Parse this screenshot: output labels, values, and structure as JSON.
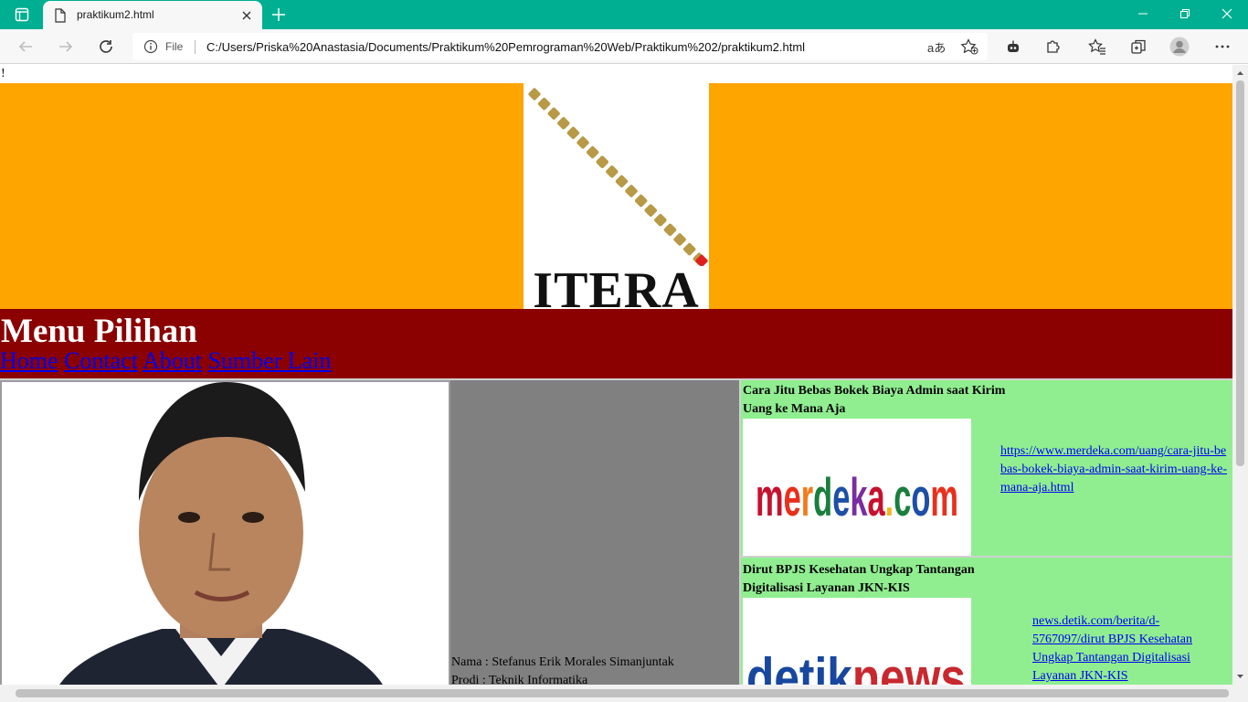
{
  "browser": {
    "tab_title": "praktikum2.html",
    "address_scheme_label": "File",
    "url": "C:/Users/Priska%20Anastasia/Documents/Praktikum%20Pemrograman%20Web/Praktikum%202/praktikum2.html",
    "read_aloud_glyph": "aあ"
  },
  "page": {
    "top_text": "!",
    "logo_text": "ITERA",
    "menu": {
      "title": "Menu Pilihan",
      "links": [
        "Home",
        "Contact",
        "About",
        "Sumber Lain"
      ]
    },
    "profile": {
      "name_line": "Nama : Stefanus Erik Morales Simanjuntak",
      "prodi_line": "Prodi : Teknik Informatika"
    },
    "news": [
      {
        "title": "Cara Jitu Bebas Bokek Biaya Admin saat Kirim Uang ke Mana Aja",
        "thumb_text": "merdeka.com",
        "link": "https://www.merdeka.com/uang/cara-jitu-bebas-bokek-biaya-admin-saat-kirim-uang-ke-mana-aja.html"
      },
      {
        "title": "Dirut BPJS Kesehatan Ungkap Tantangan Digitalisasi Layanan JKN-KIS",
        "thumb_text_a": "detik",
        "thumb_text_b": "news",
        "link": "news.detik.com/berita/d-5767097/dirut BPJS Kesehatan Ungkap Tantangan Digitalisasi Layanan JKN-KIS"
      }
    ]
  },
  "colors": {
    "tab_bar": "#00af91",
    "header": "#ffa500",
    "menu": "#8b0000",
    "profile_bg": "#808080",
    "news_bg": "#90ee90",
    "logo_diamond": "#b89945",
    "logo_red": "#e02020"
  }
}
